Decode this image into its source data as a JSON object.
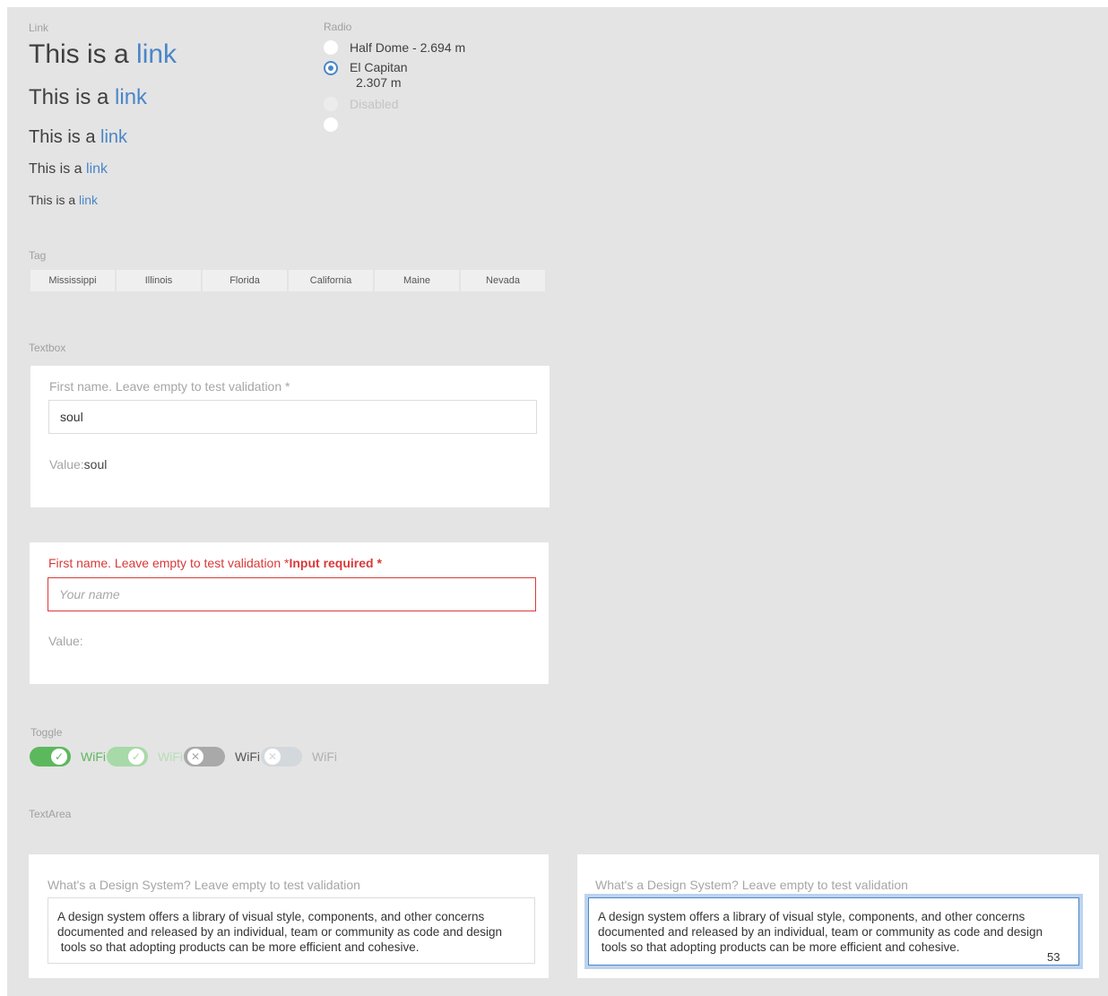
{
  "link_section": {
    "label": "Link",
    "lines": [
      {
        "prefix": "This is a ",
        "link": "link"
      },
      {
        "prefix": "This is a ",
        "link": "link"
      },
      {
        "prefix": "This is a ",
        "link": "link"
      },
      {
        "prefix": "This is a ",
        "link": "link"
      },
      {
        "prefix": "This is a ",
        "link": "link"
      }
    ]
  },
  "radio_section": {
    "label": "Radio",
    "options": [
      {
        "label": "Half Dome - 2.694 m",
        "checked": false,
        "disabled": false
      },
      {
        "label_line1": "El Capitan",
        "label_line2": "2.307 m",
        "checked": true,
        "disabled": false
      },
      {
        "label": "Disabled",
        "checked": false,
        "disabled": true
      },
      {
        "label": "",
        "checked": false,
        "disabled": false
      }
    ]
  },
  "tag_section": {
    "label": "Tag",
    "tags": [
      "Mississippi",
      "Illinois",
      "Florida",
      "California",
      "Maine",
      "Nevada"
    ]
  },
  "textbox_section": {
    "label": "Textbox",
    "valid": {
      "label": "First name. Leave empty to test validation *",
      "value": "soul",
      "value_prefix": "Value:",
      "value_text": "soul"
    },
    "invalid": {
      "label": "First name. Leave empty to test validation *",
      "error": "Input required *",
      "placeholder": "Your name",
      "value_prefix": "Value:",
      "value_text": ""
    }
  },
  "toggle_section": {
    "label": "Toggle",
    "toggles": [
      {
        "label": "WiFi",
        "state": "on",
        "disabled": false,
        "knob_glyph": "✓"
      },
      {
        "label": "WiFi",
        "state": "on",
        "disabled": true,
        "knob_glyph": "✓"
      },
      {
        "label": "WiFi",
        "state": "off",
        "disabled": false,
        "knob_glyph": "✕"
      },
      {
        "label": "WiFi",
        "state": "off",
        "disabled": true,
        "knob_glyph": "✕"
      }
    ]
  },
  "textarea_section": {
    "label": "TextArea",
    "areas": [
      {
        "label": "What's a Design System? Leave empty to test validation",
        "lines": [
          "A design system offers a library of visual style, components, and other concerns",
          "documented and released by an individual, team or community as code and design",
          " tools so that adopting products can be more efficient and cohesive."
        ],
        "focused": false
      },
      {
        "label": "What's a Design System? Leave empty to test validation",
        "lines": [
          "A design system offers a library of visual style, components, and other concerns",
          "documented and released by an individual, team or community as code and design",
          " tools so that adopting products can be more efficient and cohesive."
        ],
        "focused": true,
        "counter": "53"
      }
    ]
  },
  "colors": {
    "link": "#4a86c8",
    "error": "#d83a3a",
    "toggle_on": "#5cb85c",
    "toggle_on_disabled": "#a8d9a8",
    "toggle_off": "#a9a9a9",
    "toggle_off_disabled": "#d3d8dc",
    "background": "#e4e4e4"
  }
}
